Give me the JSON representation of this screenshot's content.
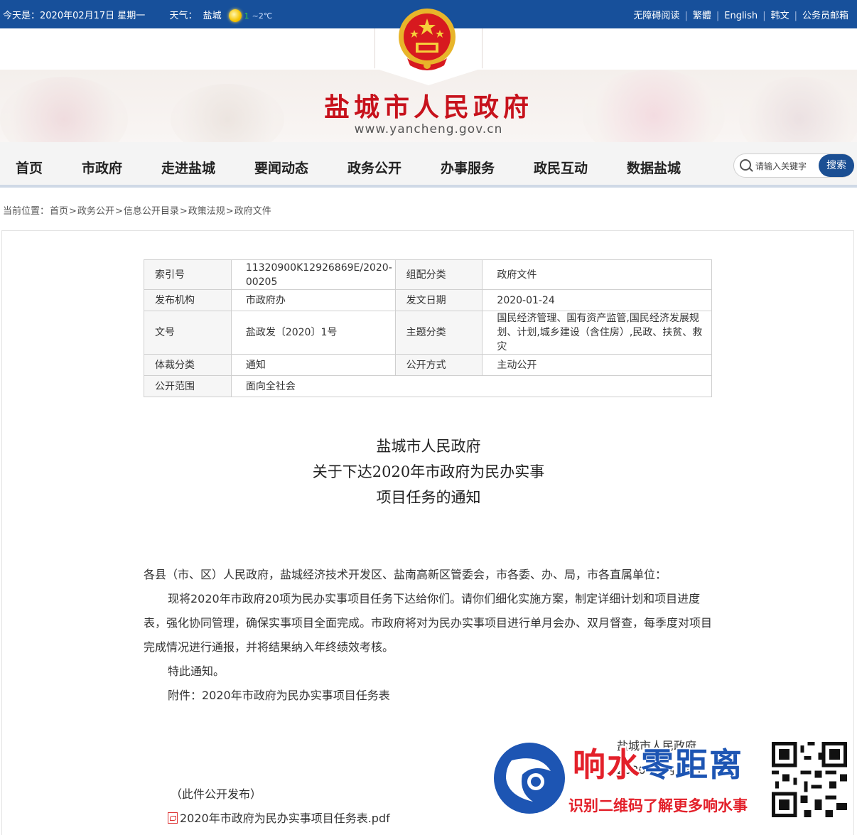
{
  "topbar": {
    "date_text": "今天是：2020年02月17日 星期一",
    "weather_label": "天气：",
    "city": "盐城",
    "temp_prefix": "1",
    "temp_text": "~2℃",
    "links": [
      "无障碍阅读",
      "繁體",
      "English",
      "韩文",
      "公务员邮箱"
    ]
  },
  "header": {
    "site_title": "盐城市人民政府",
    "site_url": "www.yancheng.gov.cn"
  },
  "nav": {
    "items": [
      "首页",
      "市政府",
      "走进盐城",
      "要闻动态",
      "政务公开",
      "办事服务",
      "政民互动",
      "数据盐城"
    ]
  },
  "search": {
    "placeholder": "请输入关键字",
    "button_label": "搜索"
  },
  "breadcrumb": {
    "prefix": "当前位置：",
    "items": [
      "首页",
      "政务公开",
      "信息公开目录",
      "政策法规",
      "政府文件"
    ],
    "separator": ">"
  },
  "meta": {
    "index_label": "索引号",
    "index_value": "11320900K12926869E/2020-00205",
    "group_label": "组配分类",
    "group_value": "政府文件",
    "org_label": "发布机构",
    "org_value": "市政府办",
    "date_label": "发文日期",
    "date_value": "2020-01-24",
    "docno_label": "文号",
    "docno_value": "盐政发〔2020〕1号",
    "topic_label": "主题分类",
    "topic_value": "国民经济管理、国有资产监管,国民经济发展规划、计划,城乡建设（含住房）,民政、扶贫、救灾",
    "genre_label": "体裁分类",
    "genre_value": "通知",
    "mode_label": "公开方式",
    "mode_value": "主动公开",
    "scope_label": "公开范围",
    "scope_value": "面向全社会"
  },
  "document": {
    "title_line1": "盐城市人民政府",
    "title_line2": "关于下达2020年市政府为民办实事",
    "title_line3": "项目任务的通知",
    "addressee": "各县（市、区）人民政府，盐城经济技术开发区、盐南高新区管委会，市各委、办、局，市各直属单位：",
    "para1": "现将2020年市政府20项为民办实事项目任务下达给你们。请你们细化实施方案，制定详细计划和项目进度表，强化协同管理，确保实事项目全面完成。市政府将对为民办实事项目进行单月会办、双月督查，每季度对项目完成情况进行通报，并将结果纳入年终绩效考核。",
    "para2": "特此通知。",
    "para3": "附件：2020年市政府为民办实事项目任务表",
    "signature": "盐城市人民政府",
    "sign_date": "2020年1月24日",
    "publish_note": "（此件公开发布）",
    "attachment": "2020年市政府为民办实事项目任务表.pdf"
  },
  "watermark": {
    "brand_red": "响水",
    "brand_blue": "零距离",
    "slogan": "识别二维码了解更多响水事"
  }
}
